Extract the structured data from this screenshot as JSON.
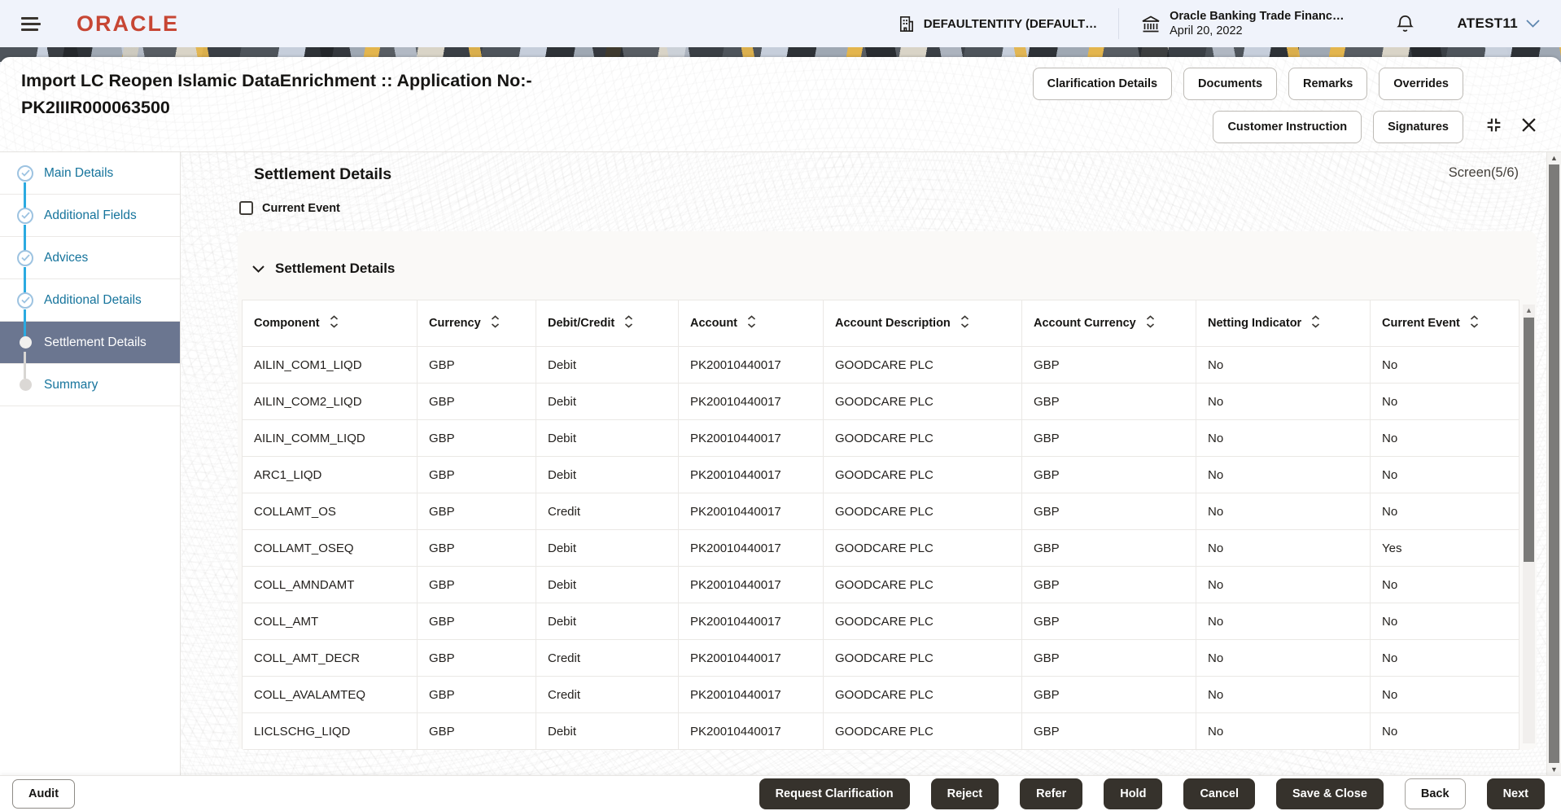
{
  "header": {
    "brand": "ORACLE",
    "entity_label": "DEFAULTENTITY (DEFAULT…",
    "app_name": "Oracle Banking Trade Financ…",
    "app_date": "April 20, 2022",
    "user": "ATEST11"
  },
  "titlebar": {
    "title_line1": "Import LC Reopen Islamic DataEnrichment :: Application No:-",
    "title_line2": "PK2IIIR000063500",
    "actions_row1": [
      "Clarification Details",
      "Documents",
      "Remarks",
      "Overrides"
    ],
    "actions_row2": [
      "Customer Instruction",
      "Signatures"
    ]
  },
  "sidebar": {
    "items": [
      {
        "label": "Main Details",
        "state": "done"
      },
      {
        "label": "Additional Fields",
        "state": "done"
      },
      {
        "label": "Advices",
        "state": "done"
      },
      {
        "label": "Additional Details",
        "state": "done"
      },
      {
        "label": "Settlement Details",
        "state": "active"
      },
      {
        "label": "Summary",
        "state": "pending"
      }
    ]
  },
  "main": {
    "heading": "Settlement Details",
    "screen_indicator": "Screen(5/6)",
    "current_event_label": "Current Event",
    "current_event_checked": false,
    "section": {
      "title": "Settlement Details",
      "table": {
        "columns": [
          "Component",
          "Currency",
          "Debit/Credit",
          "Account",
          "Account Description",
          "Account Currency",
          "Netting Indicator",
          "Current Event"
        ],
        "rows": [
          [
            "AILIN_COM1_LIQD",
            "GBP",
            "Debit",
            "PK20010440017",
            "GOODCARE PLC",
            "GBP",
            "No",
            "No"
          ],
          [
            "AILIN_COM2_LIQD",
            "GBP",
            "Debit",
            "PK20010440017",
            "GOODCARE PLC",
            "GBP",
            "No",
            "No"
          ],
          [
            "AILIN_COMM_LIQD",
            "GBP",
            "Debit",
            "PK20010440017",
            "GOODCARE PLC",
            "GBP",
            "No",
            "No"
          ],
          [
            "ARC1_LIQD",
            "GBP",
            "Debit",
            "PK20010440017",
            "GOODCARE PLC",
            "GBP",
            "No",
            "No"
          ],
          [
            "COLLAMT_OS",
            "GBP",
            "Credit",
            "PK20010440017",
            "GOODCARE PLC",
            "GBP",
            "No",
            "No"
          ],
          [
            "COLLAMT_OSEQ",
            "GBP",
            "Debit",
            "PK20010440017",
            "GOODCARE PLC",
            "GBP",
            "No",
            "Yes"
          ],
          [
            "COLL_AMNDAMT",
            "GBP",
            "Debit",
            "PK20010440017",
            "GOODCARE PLC",
            "GBP",
            "No",
            "No"
          ],
          [
            "COLL_AMT",
            "GBP",
            "Debit",
            "PK20010440017",
            "GOODCARE PLC",
            "GBP",
            "No",
            "No"
          ],
          [
            "COLL_AMT_DECR",
            "GBP",
            "Credit",
            "PK20010440017",
            "GOODCARE PLC",
            "GBP",
            "No",
            "No"
          ],
          [
            "COLL_AVALAMTEQ",
            "GBP",
            "Credit",
            "PK20010440017",
            "GOODCARE PLC",
            "GBP",
            "No",
            "No"
          ],
          [
            "LICLSCHG_LIQD",
            "GBP",
            "Debit",
            "PK20010440017",
            "GOODCARE PLC",
            "GBP",
            "No",
            "No"
          ]
        ]
      }
    }
  },
  "footer": {
    "audit_label": "Audit",
    "right_actions": [
      {
        "label": "Request Clarification",
        "variant": "dark"
      },
      {
        "label": "Reject",
        "variant": "dark"
      },
      {
        "label": "Refer",
        "variant": "dark"
      },
      {
        "label": "Hold",
        "variant": "dark"
      },
      {
        "label": "Cancel",
        "variant": "dark"
      },
      {
        "label": "Save & Close",
        "variant": "dark"
      },
      {
        "label": "Back",
        "variant": "light"
      },
      {
        "label": "Next",
        "variant": "dark"
      }
    ]
  },
  "colors": {
    "brand_red": "#C74634",
    "topbar_bg": "#F0F3FB",
    "ink": "#161513",
    "sidebar_link": "#16749C",
    "sidebar_active_bg": "#6B7690",
    "progress_line": "#2BAAE1",
    "progress_circle": "#9DC3E1",
    "panel_bg": "#FAF9F7",
    "button_dark_bg": "#36322C"
  }
}
